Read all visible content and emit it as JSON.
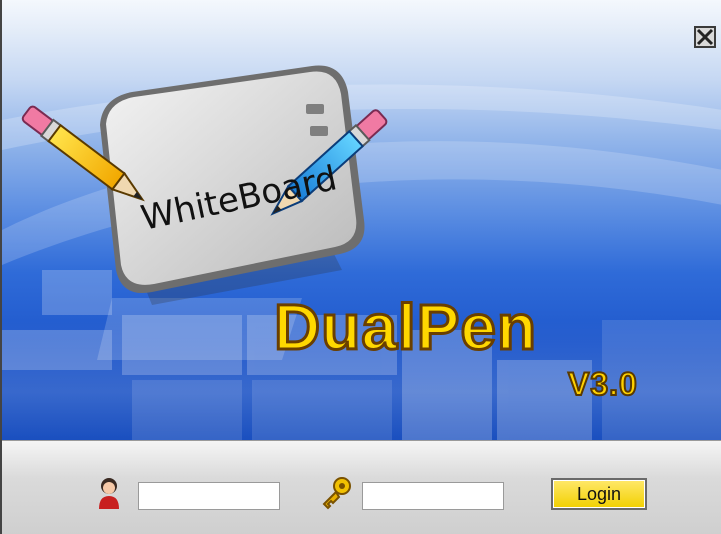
{
  "splash": {
    "board_label": "WhiteBoard",
    "product_name": "DualPen",
    "version": "V3.0"
  },
  "login": {
    "username_value": "",
    "password_value": "",
    "login_label": "Login"
  },
  "icons": {
    "close": "close-icon",
    "user": "user-icon",
    "key": "key-icon"
  },
  "colors": {
    "title_yellow": "#ffd800",
    "background_blue": "#1f58cc"
  }
}
